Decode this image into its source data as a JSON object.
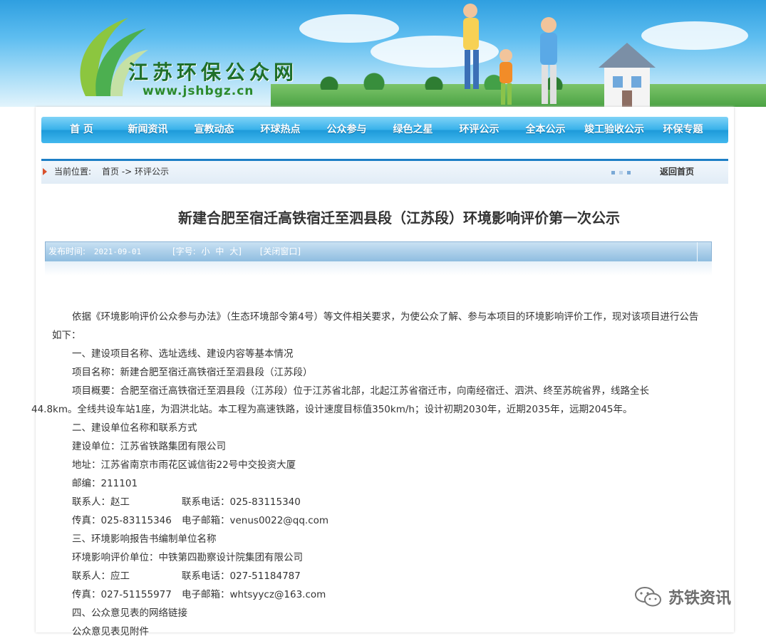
{
  "header": {
    "site_name": "江苏环保公众网",
    "site_url": "www.jshbgz.cn"
  },
  "nav": {
    "items": [
      "首 页",
      "新闻资讯",
      "宣教动态",
      "环球热点",
      "公众参与",
      "绿色之星",
      "环评公示",
      "全本公示",
      "竣工验收公示",
      "环保专题"
    ]
  },
  "breadcrumb": {
    "label": "当前位置:",
    "path": "首页 -> 环评公示",
    "back": "返回首页"
  },
  "article": {
    "title": "新建合肥至宿迁高铁宿迁至泗县段（江苏段）环境影响评价第一次公示",
    "meta": {
      "publish_label": "发布时间:",
      "publish_date": "2021-09-01",
      "font_size_label": "[字号:",
      "font_small": "小",
      "font_medium": "中",
      "font_large": "大]",
      "close": "[关闭窗口]"
    },
    "intro": "依据《环境影响评价公众参与办法》（生态环境部令第4号）等文件相关要求，为使公众了解、参与本项目的环境影响评价工作，现对该项目进行公告如下：",
    "s1_heading": "一、建设项目名称、选址选线、建设内容等基本情况",
    "project_name": "项目名称：新建合肥至宿迁高铁宿迁至泗县段（江苏段）",
    "overview_line1": "项目概要：合肥至宿迁高铁宿迁至泗县段（江苏段）位于江苏省北部，北起江苏省宿迁市，向南经宿迁、泗洪、终至苏皖省界，线路全长",
    "overview_line2": "44.8km。全线共设车站1座，为泗洪北站。本工程为高速铁路，设计速度目标值350km/h；设计初期2030年，近期2035年，远期2045年。",
    "s2_heading": "二、建设单位名称和联系方式",
    "builder": "建设单位：江苏省铁路集团有限公司",
    "address": "地址：江苏省南京市雨花区诚信街22号中交投资大厦",
    "postcode": "邮编：211101",
    "contact1_name": "联系人：赵工",
    "contact1_phone": "联系电话：025-83115340",
    "fax1": "传真：025-83115346",
    "email1": "电子邮箱：venus0022@qq.com",
    "s3_heading": "三、环境影响报告书编制单位名称",
    "eia_unit": "环境影响评价单位：中铁第四勘察设计院集团有限公司",
    "contact2_name": "联系人：应工",
    "contact2_phone": "联系电话：027-51184787",
    "fax2": "传真：027-51155977",
    "email2": "电子邮箱：whtsyycz@163.com",
    "s4_heading": "四、公众意见表的网络链接",
    "s4_partial": "公众意见表见附件"
  },
  "watermark": {
    "text": "苏铁资讯",
    "icon": "wechat-icon"
  }
}
